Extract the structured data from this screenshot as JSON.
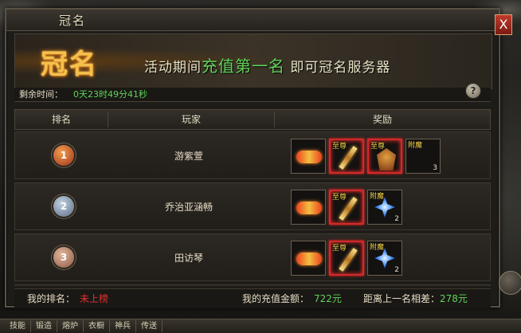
{
  "window": {
    "title": "冠名",
    "close_label": "X"
  },
  "banner": {
    "logo": "冠名",
    "text_before": "活动期间",
    "text_highlight": "充值第一名",
    "text_after": "即可冠名服务器"
  },
  "timer": {
    "label": "剩余时间：",
    "value": "0天23时49分41秒"
  },
  "help_label": "?",
  "table": {
    "headers": [
      "排名",
      "玩家",
      "奖励"
    ],
    "rows": [
      {
        "rank": "1",
        "player": "游紫萱",
        "rewards": [
          {
            "icon": "wings-icon",
            "tag": "",
            "qty": ""
          },
          {
            "icon": "sword-icon",
            "tag": "至尊",
            "qty": ""
          },
          {
            "icon": "armor-icon",
            "tag": "至尊",
            "qty": ""
          },
          {
            "icon": "empty-slot-icon",
            "tag": "附魔",
            "qty": "3"
          }
        ]
      },
      {
        "rank": "2",
        "player": "乔治亚涵畅",
        "rewards": [
          {
            "icon": "wings-icon",
            "tag": "",
            "qty": ""
          },
          {
            "icon": "sword-icon",
            "tag": "至尊",
            "qty": ""
          },
          {
            "icon": "gem-icon",
            "tag": "附魔",
            "qty": "2"
          }
        ]
      },
      {
        "rank": "3",
        "player": "田访琴",
        "rewards": [
          {
            "icon": "wings-icon",
            "tag": "",
            "qty": ""
          },
          {
            "icon": "sword-icon",
            "tag": "至尊",
            "qty": ""
          },
          {
            "icon": "gem-icon",
            "tag": "附魔",
            "qty": "2"
          }
        ]
      }
    ]
  },
  "footer": {
    "my_rank_label": "我的排名：",
    "my_rank_value": "未上榜",
    "recharge_label": "我的充值金额：",
    "recharge_value": "722元",
    "gap_label": "距离上一名相差：",
    "gap_value": "278元"
  },
  "hotbar": [
    "技能",
    "锻造",
    "熔炉",
    "衣橱",
    "神兵",
    "传送"
  ],
  "colors": {
    "highlight_green": "#5fd35a",
    "warning_red": "#e03030",
    "gold": "#f5c04a"
  }
}
